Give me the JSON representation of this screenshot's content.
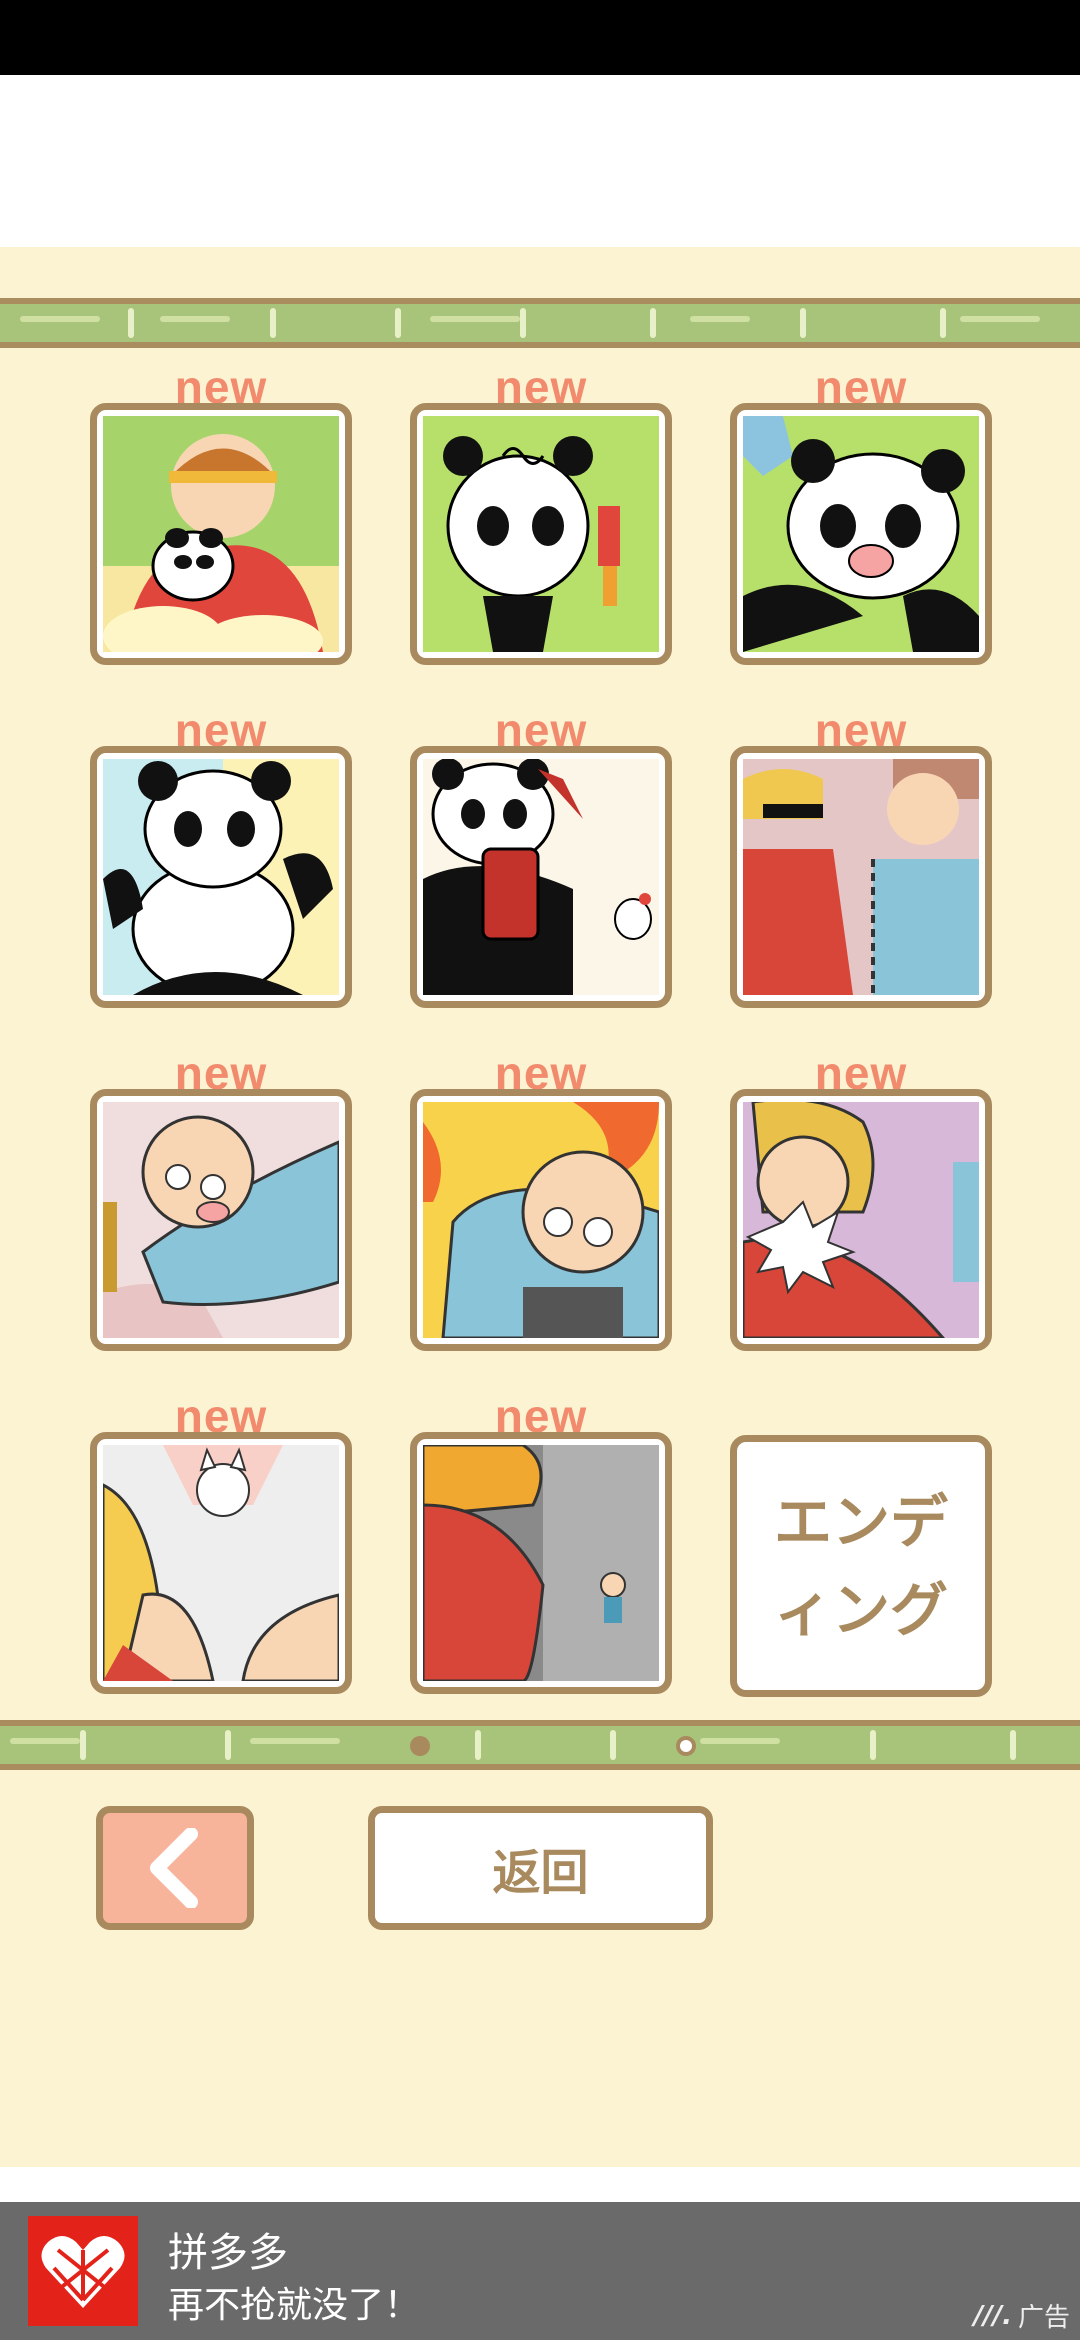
{
  "tiles": [
    {
      "label": "new",
      "scene": "monkey-king-holding-panda"
    },
    {
      "label": "new",
      "scene": "dizzy-panda"
    },
    {
      "label": "new",
      "scene": "crying-panda"
    },
    {
      "label": "new",
      "scene": "happy-panda"
    },
    {
      "label": "new",
      "scene": "panda-with-oil-drum"
    },
    {
      "label": "new",
      "scene": "workers-in-overalls"
    },
    {
      "label": "new",
      "scene": "knocked-out-old-man"
    },
    {
      "label": "new",
      "scene": "old-man-in-fire"
    },
    {
      "label": "new",
      "scene": "shouting-blond-worker"
    },
    {
      "label": "new",
      "scene": "angry-cat-alert"
    },
    {
      "label": "new",
      "scene": "tiny-old-man-in-corridor"
    }
  ],
  "ending": {
    "label": "エンデ\nィング"
  },
  "pager": {
    "active": 1,
    "total": 2
  },
  "buttons": {
    "back_label": "返回",
    "prev_icon": "chevron-left-icon"
  },
  "ad": {
    "title": "拼多多",
    "subtitle": "再不抢就没了！",
    "tag": "广告",
    "logo_icon": "pinduoduo-logo-icon"
  },
  "colors": {
    "background": "#fbf3d2",
    "frame": "#a88a5e",
    "new_label": "#f28a6e",
    "bamboo": "#a8c47a",
    "prev_button": "#f8b49a"
  }
}
